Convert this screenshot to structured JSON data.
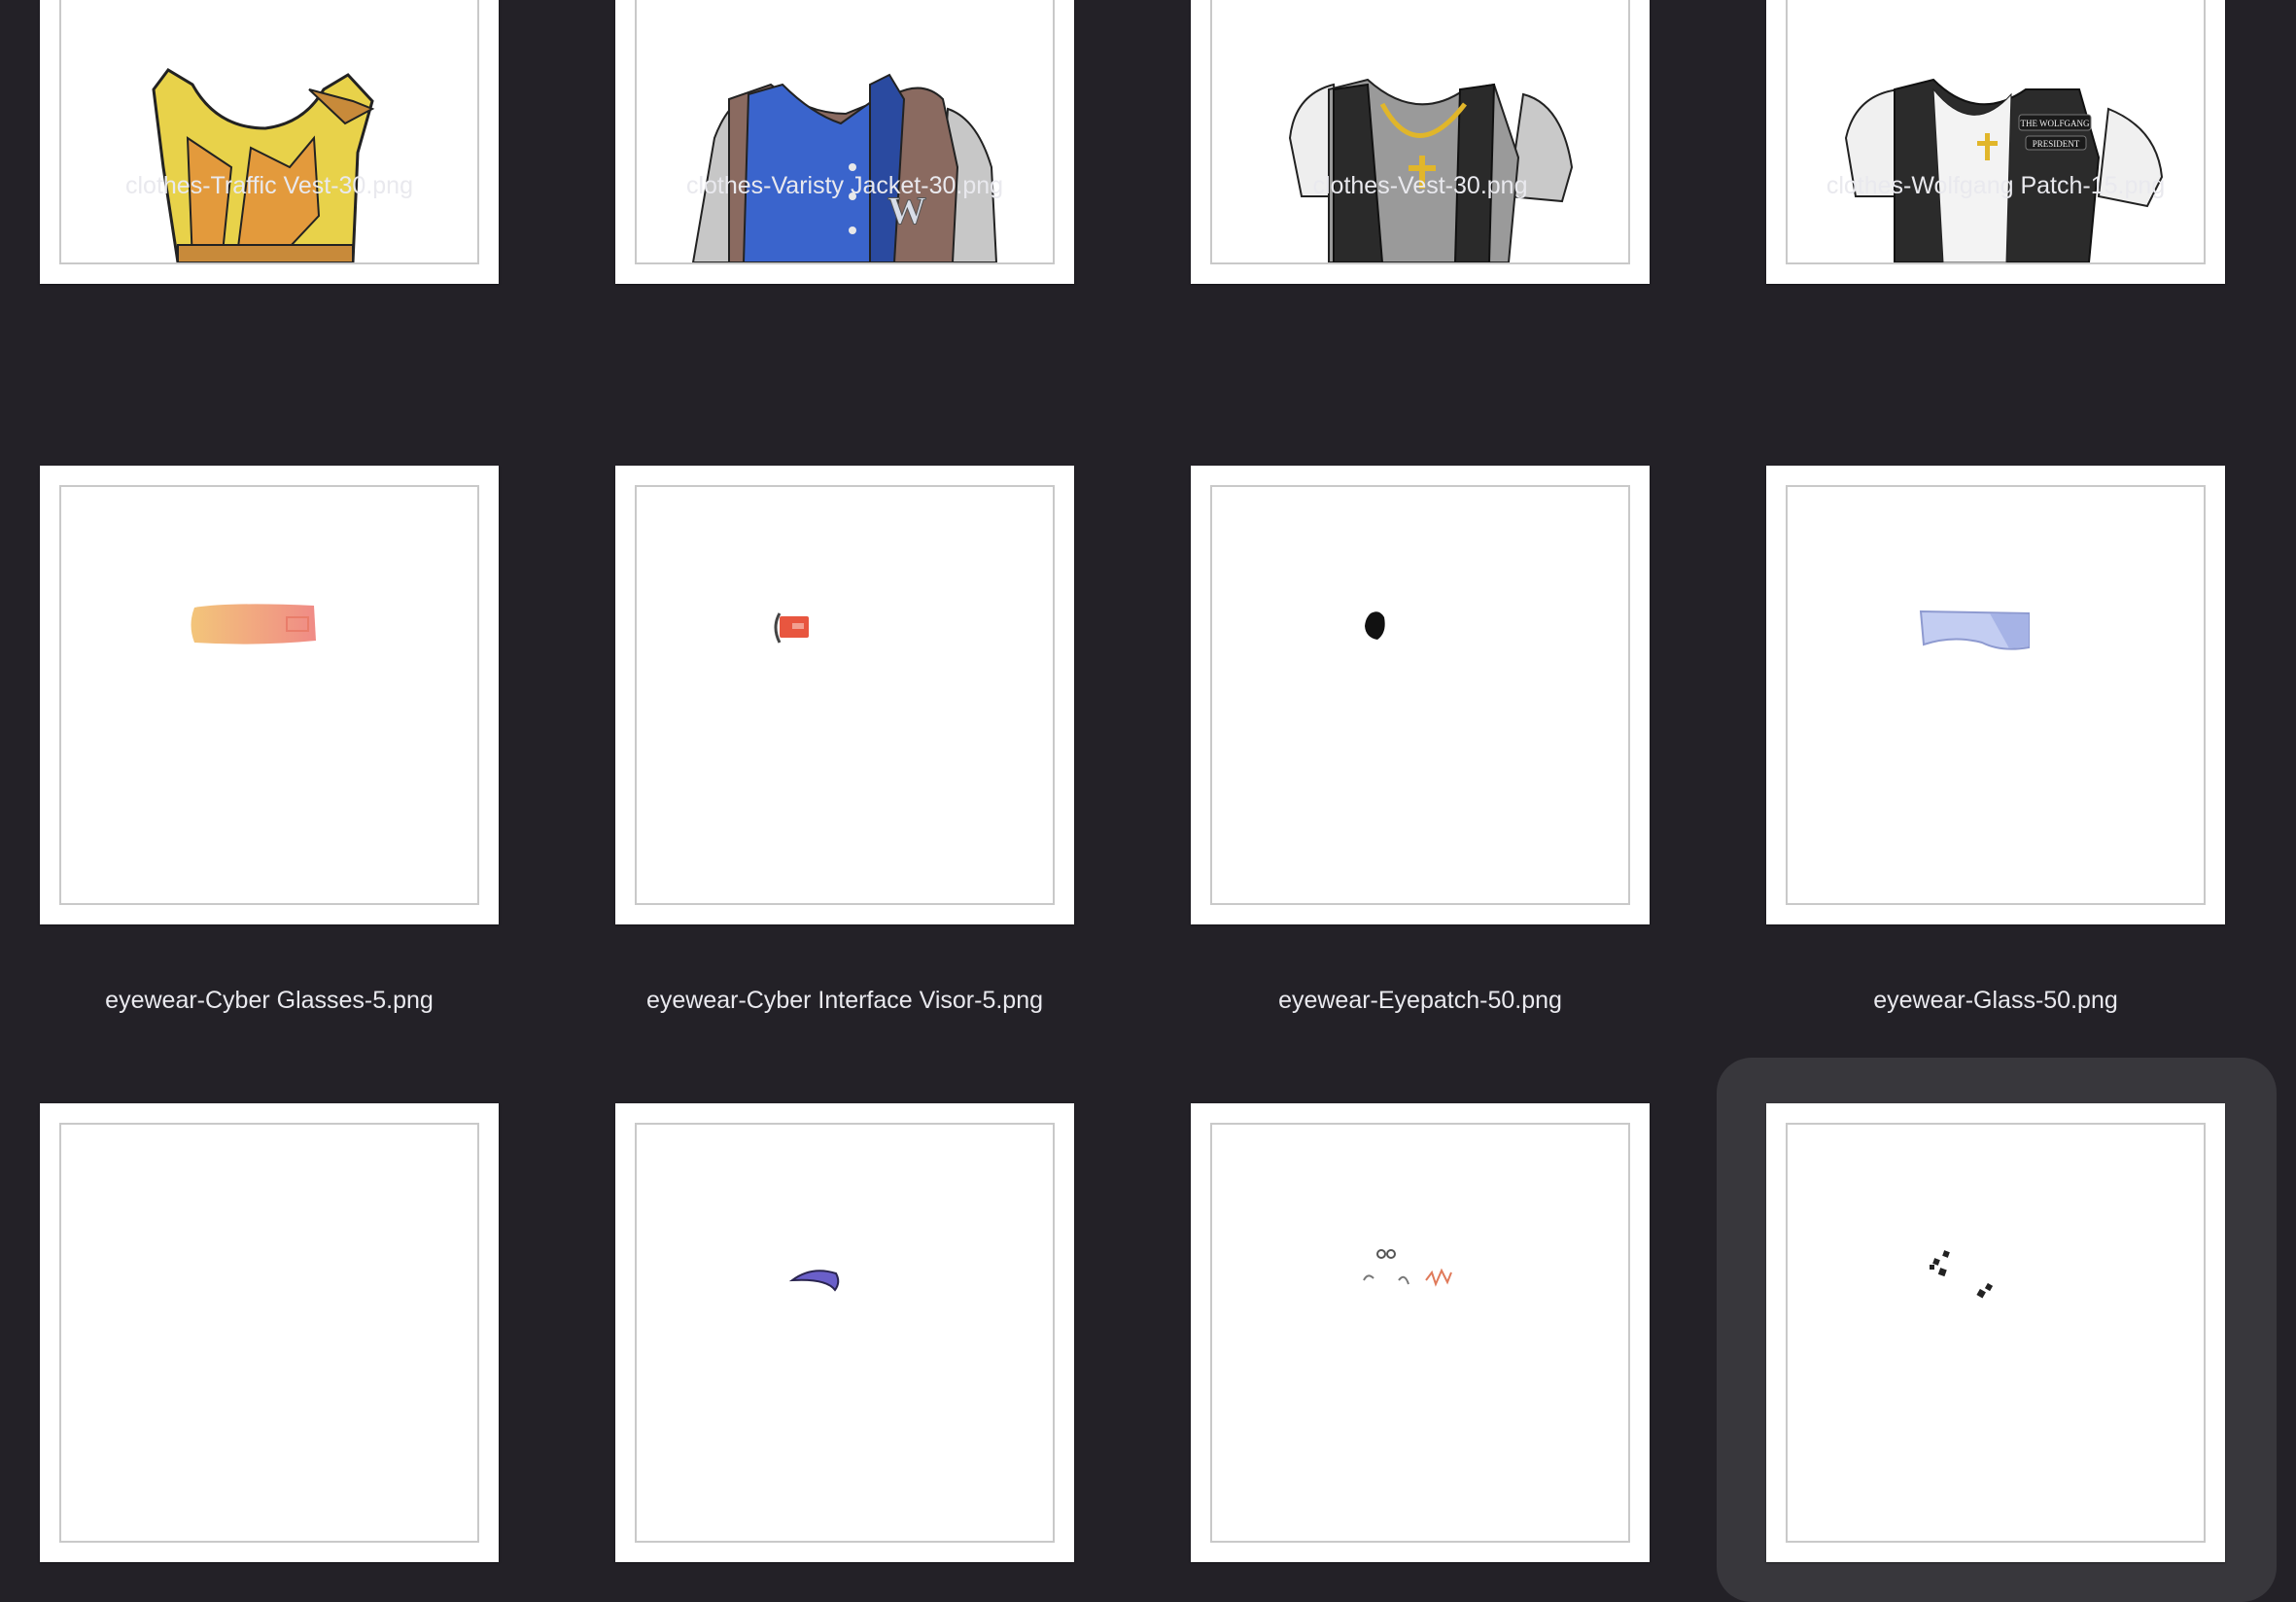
{
  "files": [
    {
      "name": "clothes-Traffic Vest-30.png",
      "thumb_icon": "traffic-vest-thumbnail"
    },
    {
      "name": "clothes-Varisty Jacket-30.png",
      "thumb_icon": "varsity-jacket-thumbnail",
      "badge_letter": "W"
    },
    {
      "name": "clothes-Vest-30.png",
      "thumb_icon": "tactical-vest-thumbnail"
    },
    {
      "name": "clothes-Wolfgang Patch-15.png",
      "thumb_icon": "wolfgang-patch-vest-thumbnail",
      "patch_line1": "THE WOLFGANG",
      "patch_line2": "PRESIDENT"
    },
    {
      "name": "eyewear-Cyber Glasses-5.png",
      "thumb_icon": "cyber-glasses-thumbnail"
    },
    {
      "name": "eyewear-Cyber Interface Visor-5.png",
      "thumb_icon": "cyber-visor-thumbnail"
    },
    {
      "name": "eyewear-Eyepatch-50.png",
      "thumb_icon": "eyepatch-thumbnail"
    },
    {
      "name": "eyewear-Glass-50.png",
      "thumb_icon": "glass-thumbnail"
    },
    {
      "name": "",
      "thumb_icon": "blank-thumbnail"
    },
    {
      "name": "",
      "thumb_icon": "purple-brow-thumbnail"
    },
    {
      "name": "",
      "thumb_icon": "small-marks-thumbnail"
    },
    {
      "name": "",
      "thumb_icon": "dark-marks-thumbnail",
      "selected": true
    }
  ],
  "colors": {
    "background": "#232127",
    "selection": "#38373c",
    "label_text": "#e9e9ee",
    "thumb_border": "#c9c9c9"
  }
}
